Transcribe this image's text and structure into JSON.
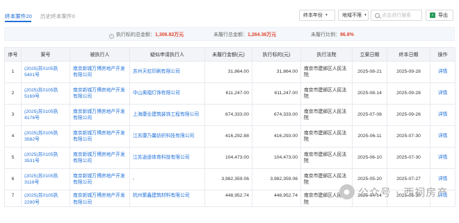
{
  "tabs": {
    "active_label": "终本案件",
    "active_count": "20",
    "inactive_label": "历史终本案件",
    "inactive_count": "0"
  },
  "toolbar": {
    "year_filter": "终本年份",
    "area_filter": "地域不限",
    "search_placeholder": "点击进行搜索",
    "export_label": "导出"
  },
  "summary": {
    "target_label": "执行标的总金额：",
    "target_value": "1,306.82万元",
    "unfulfilled_label": "未履行总金额：",
    "unfulfilled_value": "1,264.36万元",
    "ratio_label": "未履行比例：",
    "ratio_value": "96.8%"
  },
  "table": {
    "headers": [
      "序号",
      "案号",
      "被执行人",
      "疑似申请执行人",
      "未履行金额(元)",
      "执行标的(元)",
      "执行法院",
      "立案日期",
      "终本日期",
      "操作"
    ],
    "rows": [
      {
        "idx": "1",
        "case_no": "(2025)苏0105执5401号",
        "respondent": "南京新城万博房地产开发有限公司",
        "applicant": "苏州天虹印刷有限公司",
        "unfulfilled": "31,864.00",
        "target": "31,864.00",
        "court": "南京市建邺区人民法院",
        "filed": "2025-08-21",
        "closed": "2025-09-28",
        "op": "详情"
      },
      {
        "idx": "2",
        "case_no": "(2025)苏0105执5169号",
        "respondent": "南京新城万博房地产开发有限公司",
        "applicant": "中山奥福灯饰有限公司",
        "unfulfilled": "611,247.00",
        "target": "611,247.00",
        "court": "南京市建邺区人民法院",
        "filed": "2025-08-14",
        "closed": "2025-09-28",
        "op": "详情"
      },
      {
        "idx": "3",
        "case_no": "(2025)苏0105执4176号",
        "respondent": "南京新城万博房地产开发有限公司",
        "applicant": "上海康业建筑装饰工程有限公司",
        "unfulfilled": "674,333.00",
        "target": "674,333.00",
        "court": "南京市建邺区人民法院",
        "filed": "2025-07-08",
        "closed": "2025-09-26",
        "op": "详情"
      },
      {
        "idx": "4",
        "case_no": "(2025)苏0105执3582号",
        "respondent": "南京新城万博房地产开发有限公司",
        "applicant": "江苏康乃馨纺织科技有限公司",
        "unfulfilled": "416,292.88",
        "target": "416,293.00",
        "court": "南京市建邺区人民法院",
        "filed": "2025-06-11",
        "closed": "2025-07-30",
        "op": "详情"
      },
      {
        "idx": "5",
        "case_no": "(2025)苏0105执3531号",
        "respondent": "南京新城万博房地产开发有限公司",
        "applicant": "江苏逍遥体育科技有限公司",
        "unfulfilled": "104,473.00",
        "target": "104,473.00",
        "court": "南京市建邺区人民法院",
        "filed": "2025-06-10",
        "closed": "2025-07-30",
        "op": "详情"
      },
      {
        "idx": "6",
        "case_no": "(2025)苏0105执3116号",
        "respondent": "南京新城万博房地产开发有限公司",
        "applicant": "-",
        "unfulfilled": "3,982,359.06",
        "target": "3,982,359.06",
        "court": "南京市建邺区人民法院",
        "filed": "2025-05-20",
        "closed": "2025-07-27",
        "op": "详情"
      },
      {
        "idx": "7",
        "case_no": "(2025)苏0105执2290号",
        "respondent": "南京新城万博房地产开发有限公司",
        "applicant": "杭州聚鑫建筑材料有限公司",
        "unfulfilled": "448,952.74",
        "target": "448,952.74",
        "court": "南京市建邺区人民法院",
        "filed": "2025-04-14",
        "closed": "2025-05-30",
        "op": "详情"
      }
    ]
  },
  "watermark": {
    "text": "公众号 · 西祠房产"
  },
  "colors": {
    "accent": "#1e6fd9",
    "amount_red": "#e0452e",
    "header_bg": "#f2f4f8",
    "summary_bg": "#f4f7fb"
  }
}
